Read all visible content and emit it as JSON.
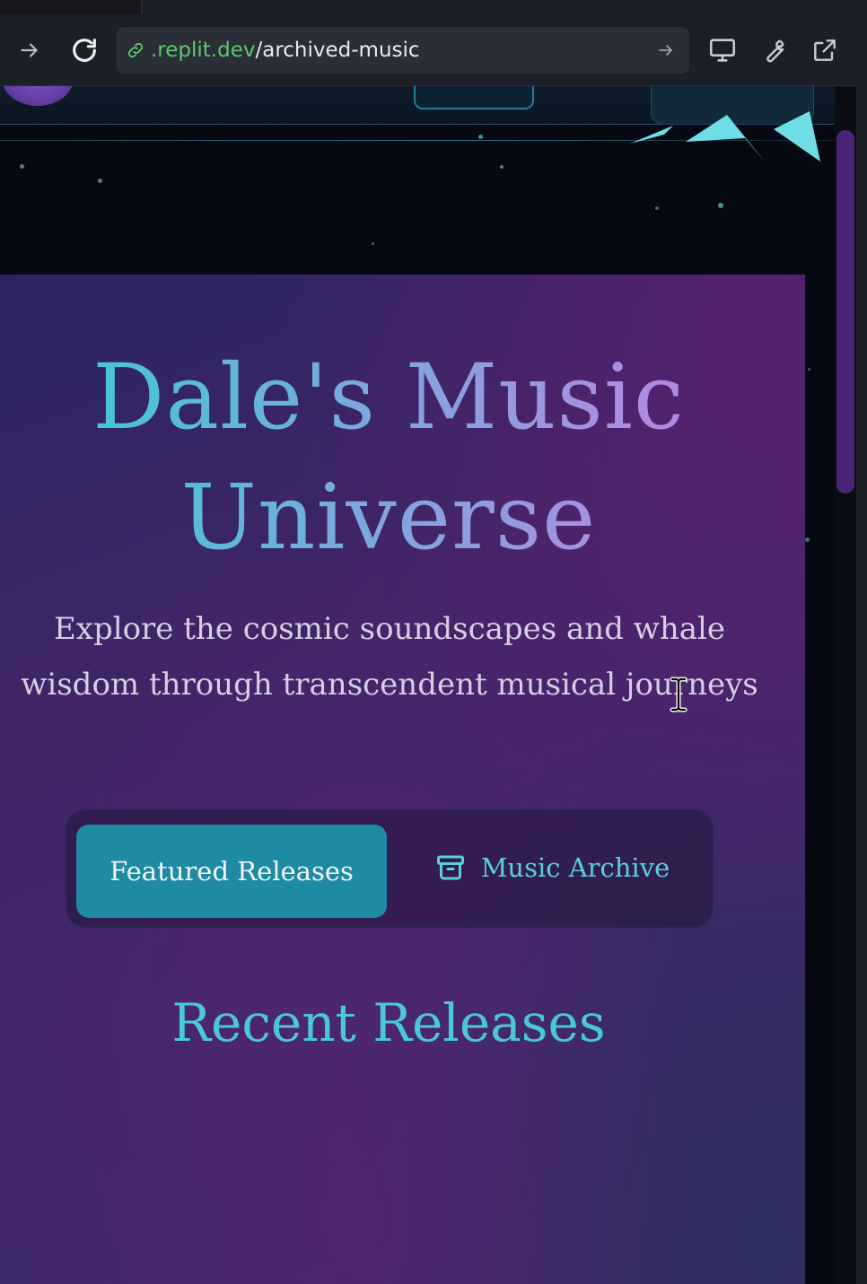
{
  "browser": {
    "url_domain": ".replit.dev",
    "url_path": "/archived-music",
    "icons": {
      "forward": "arrow-right-icon",
      "reload": "reload-icon",
      "link": "link-icon",
      "go": "arrow-right-icon",
      "device": "monitor-icon",
      "devtools": "wrench-icon",
      "open_external": "external-link-icon"
    }
  },
  "hero": {
    "title": "Dale's Music Universe",
    "subtitle": "Explore the cosmic soundscapes and whale wisdom through transcendent musical journeys"
  },
  "tabs": {
    "featured_label": "Featured Releases",
    "archive_label": "Music Archive",
    "active": "featured"
  },
  "section": {
    "title": "Recent Releases"
  },
  "colors": {
    "accent_teal": "#1f8aa3",
    "title_teal": "#48c9d6",
    "title_violet": "#b08ae2",
    "background_purple": "#42266c",
    "url_domain_green": "#5fc870",
    "scrollbar": "#4a2477"
  }
}
